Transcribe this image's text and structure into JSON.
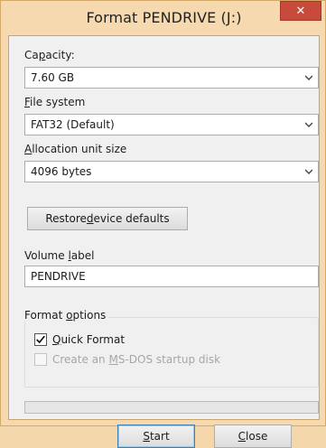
{
  "window": {
    "title": "Format PENDRIVE (J:)",
    "close_glyph": "✕"
  },
  "capacity": {
    "label_pre": "Ca",
    "label_key": "p",
    "label_post": "acity:",
    "value": "7.60 GB"
  },
  "file_system": {
    "label_key": "F",
    "label_post": "ile system",
    "value": "FAT32 (Default)"
  },
  "allocation": {
    "label_key": "A",
    "label_post": "llocation unit size",
    "value": "4096 bytes"
  },
  "restore": {
    "label_pre": "Restore ",
    "label_key": "d",
    "label_post": "evice defaults"
  },
  "volume": {
    "label_pre": "Volume ",
    "label_key": "l",
    "label_post": "abel",
    "value": "PENDRIVE"
  },
  "format_options": {
    "title_pre": "Format ",
    "title_key": "o",
    "title_post": "ptions",
    "quick": {
      "label_key": "Q",
      "label_post": "uick Format",
      "checked": true
    },
    "msdos": {
      "label_pre": "Create an ",
      "label_key": "M",
      "label_post": "S-DOS startup disk",
      "checked": false,
      "disabled": true
    }
  },
  "progress": {
    "value": 0
  },
  "buttons": {
    "start": {
      "label_key": "S",
      "label_post": "tart"
    },
    "close": {
      "label_key": "C",
      "label_post": "lose"
    }
  },
  "colors": {
    "frame": "#f6d9ae",
    "close_red": "#c84a3b",
    "client": "#f0f0f0"
  },
  "icons": {
    "dropdown": "chevron-down-icon",
    "check": "checkmark-icon"
  }
}
